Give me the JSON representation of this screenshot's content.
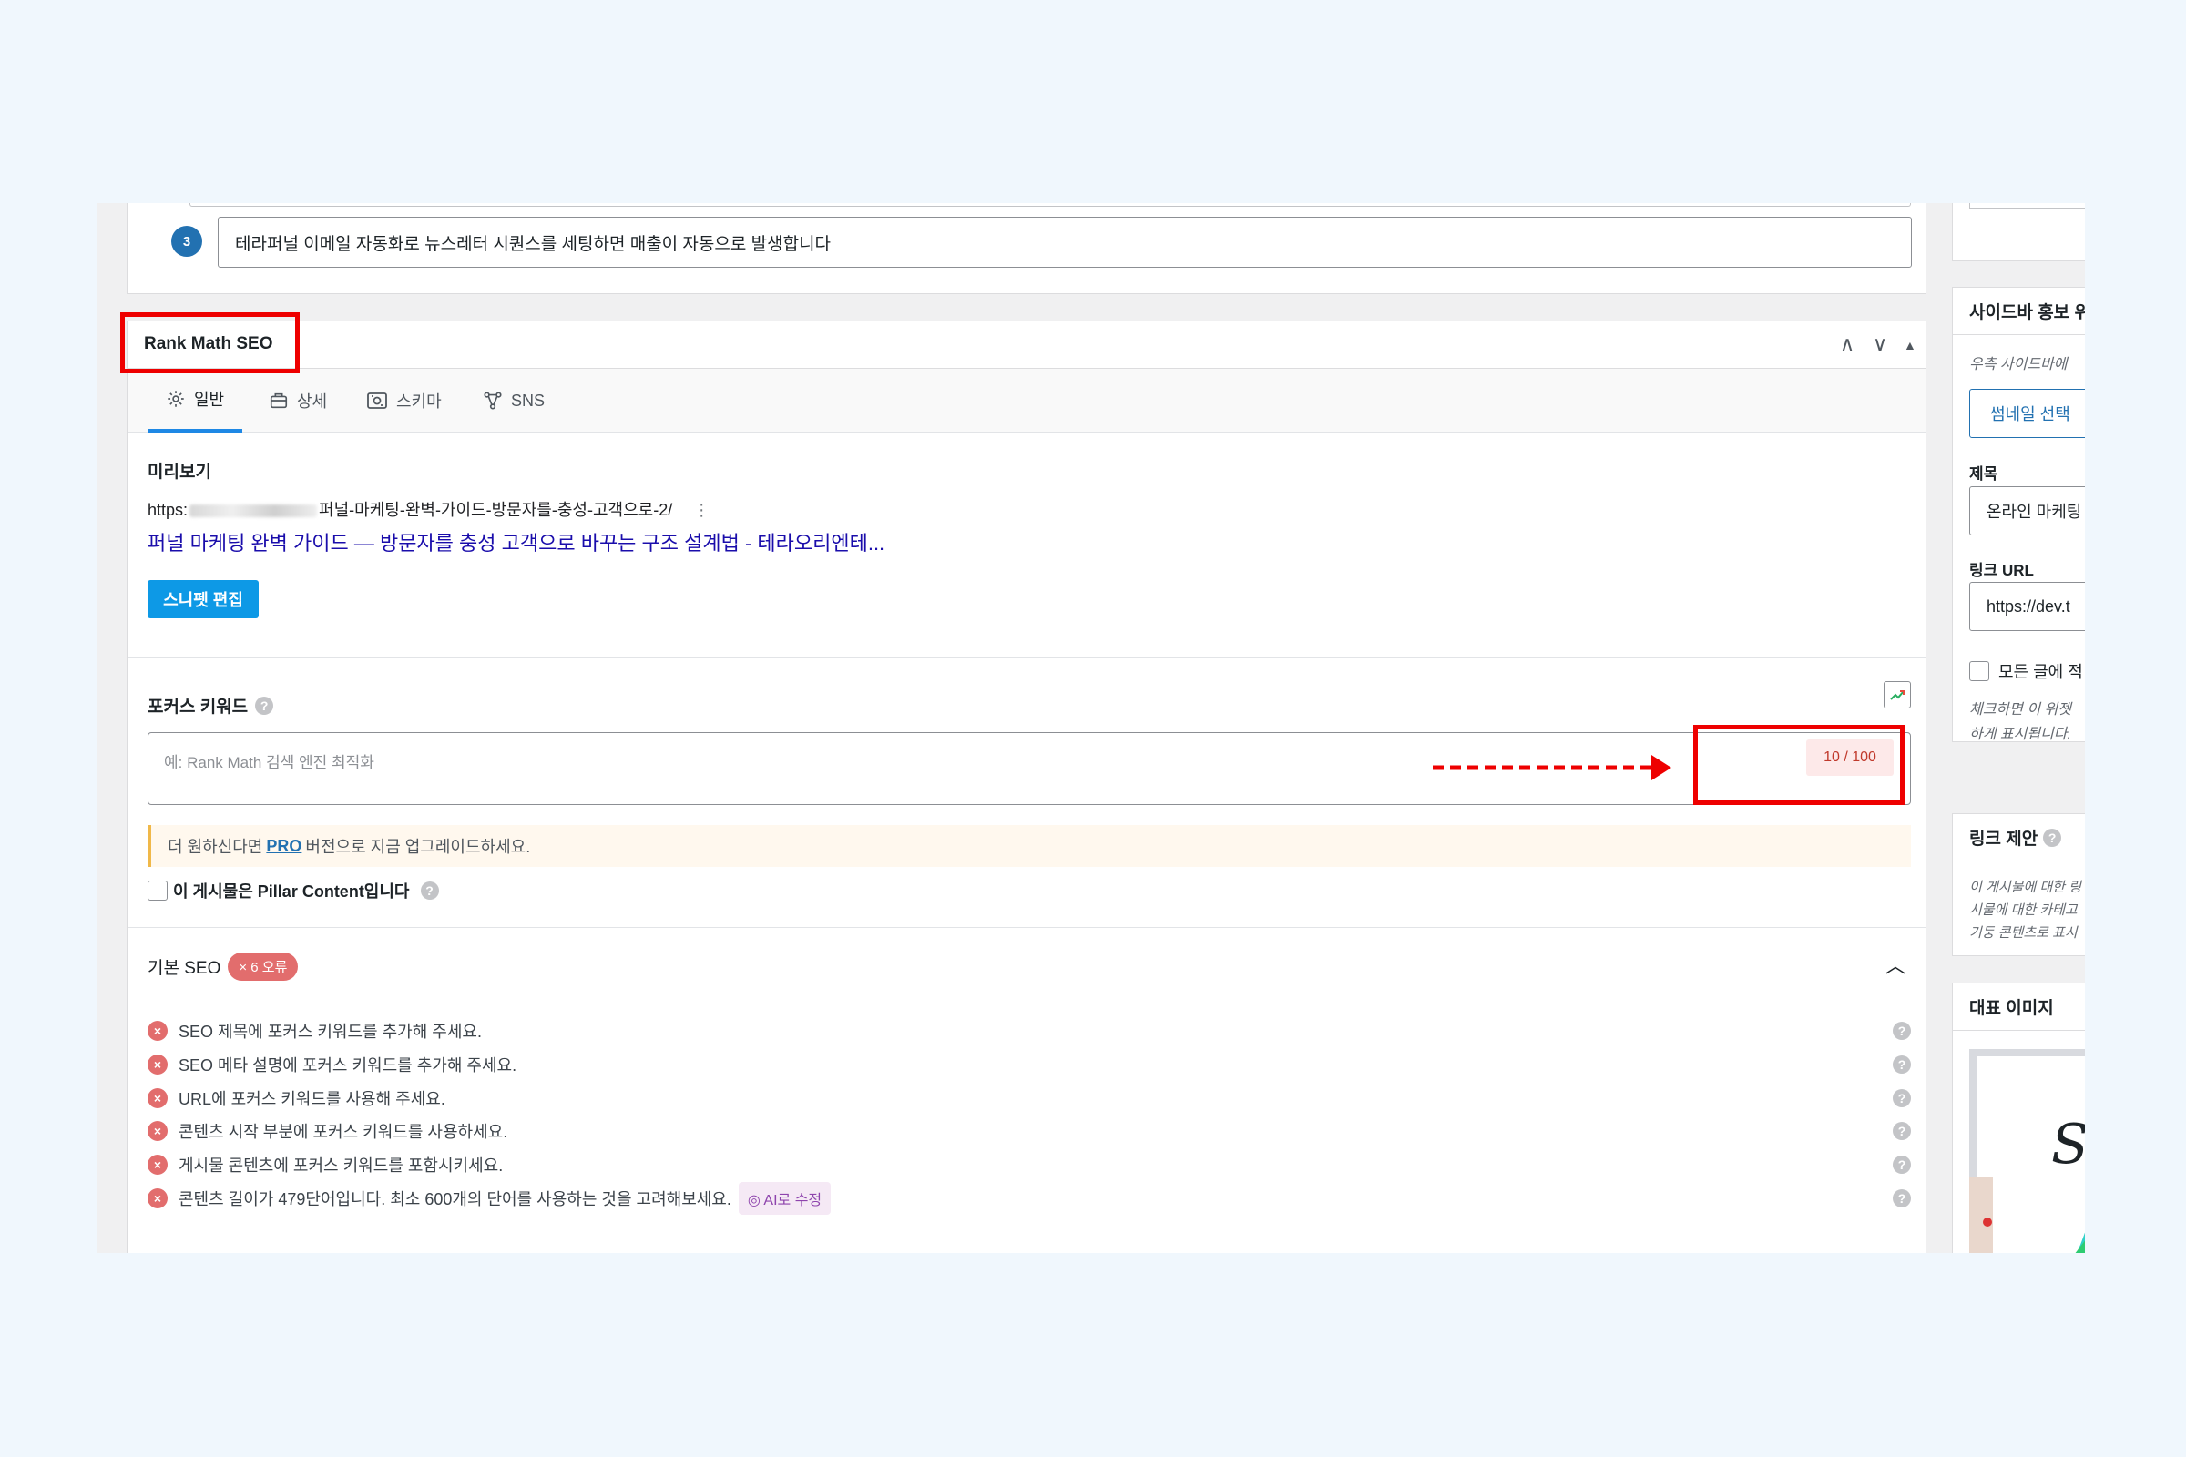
{
  "faq": {
    "number": "3",
    "text": "테라퍼널 이메일 자동화로 뉴스레터 시퀀스를 세팅하면 매출이 자동으로 발생합니다"
  },
  "rankmath": {
    "title": "Rank Math SEO",
    "controls": {
      "up": "∧",
      "down": "∨",
      "toggle": "▲"
    },
    "tabs": [
      {
        "label": "일반",
        "icon": "gear-icon"
      },
      {
        "label": "상세",
        "icon": "briefcase-icon"
      },
      {
        "label": "스키마",
        "icon": "schema-icon"
      },
      {
        "label": "SNS",
        "icon": "share-icon"
      }
    ],
    "preview": {
      "heading": "미리보기",
      "url_prefix": "https:",
      "url_path": "퍼널-마케팅-완벽-가이드-방문자를-충성-고객으로-2/",
      "more": "⋮",
      "title": "퍼널 마케팅 완벽 가이드 — 방문자를 충성 고객으로 바꾸는 구조 설계법 - 테라오리엔테...",
      "edit_button": "스니펫 편집"
    },
    "focus": {
      "label": "포커스 키워드",
      "placeholder": "예: Rank Math 검색 엔진 최적화",
      "counter": "10 / 100",
      "notice_before": "더 원하신다면",
      "notice_link": "PRO",
      "notice_after": "버전으로 지금 업그레이드하세요.",
      "pillar": "이 게시물은 Pillar Content입니다"
    },
    "basic_seo": {
      "title": "기본 SEO",
      "badge": "× 6 오류",
      "checks": [
        "SEO 제목에 포커스 키워드를 추가해 주세요.",
        "SEO 메타 설명에 포커스 키워드를 추가해 주세요.",
        "URL에 포커스 키워드를 사용해 주세요.",
        "콘텐츠 시작 부분에 포커스 키워드를 사용하세요.",
        "게시물 콘텐츠에 포커스 키워드를 포함시키세요.",
        "콘텐츠 길이가 479단어입니다. 최소 600개의 단어를 사용하는 것을 고려해보세요."
      ],
      "ai_fix": "AI로 수정"
    }
  },
  "sidebar": {
    "promo": {
      "heading": "사이드바 홍보 위",
      "description": "우측 사이드바에",
      "thumb_button": "썸네일 선택",
      "title_label": "제목",
      "title_value": "온라인 마케팅",
      "url_label": "링크 URL",
      "url_value": "https://dev.t",
      "checkbox_label": "모든 글에 적",
      "help_line1": "체크하면 이 위젯",
      "help_line2": "하게 표시됩니다."
    },
    "links": {
      "heading": "링크 제안",
      "line1": "이 게시물에 대한 링",
      "line2": "시물에 대한 카테고",
      "line3": "기둥 콘텐츠로 표시"
    },
    "featured": {
      "heading": "대표 이미지",
      "image_text": "S"
    }
  }
}
